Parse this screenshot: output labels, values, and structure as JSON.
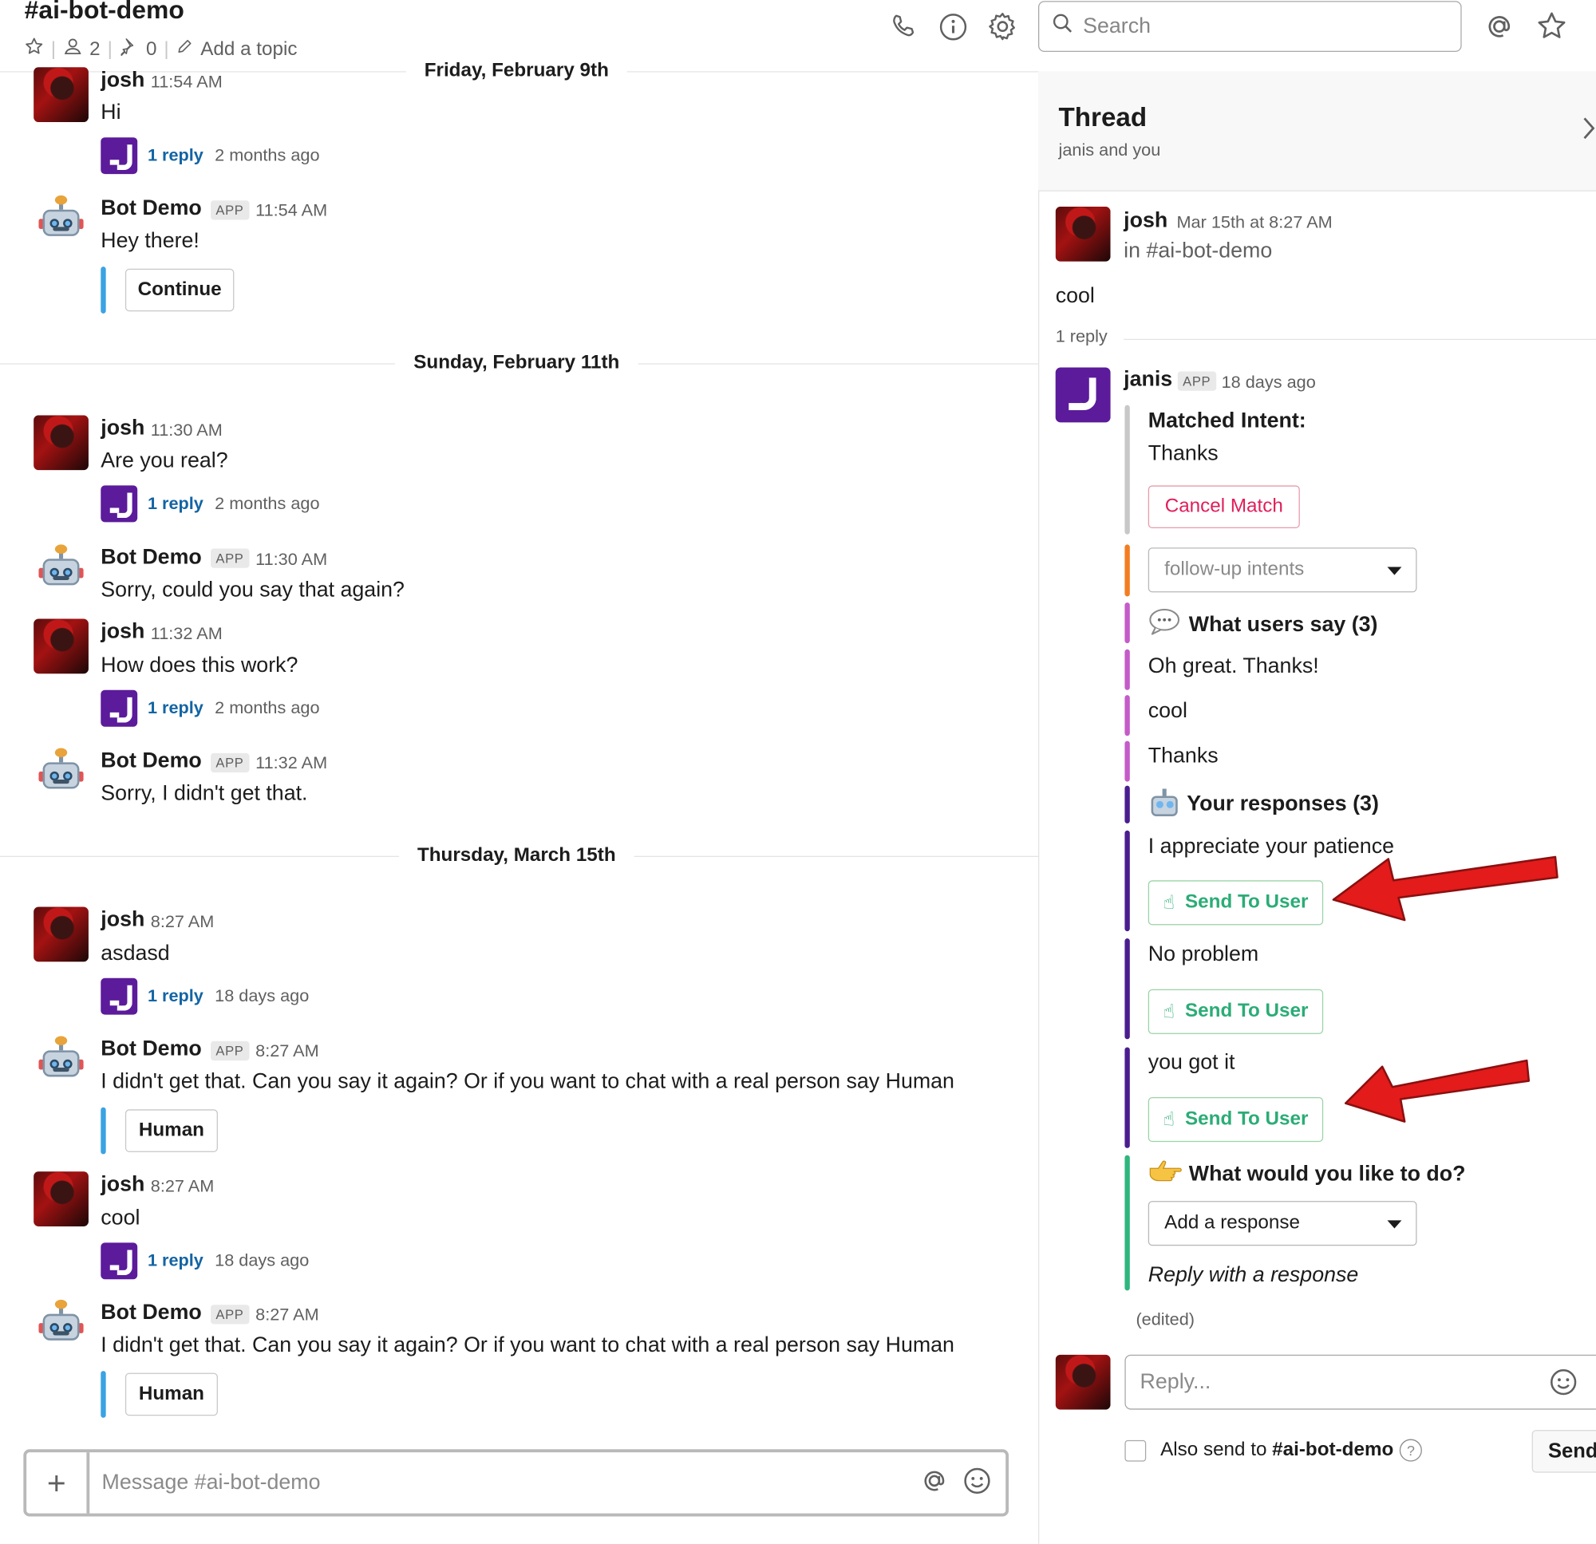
{
  "channel": {
    "name": "#ai-bot-demo",
    "members": "2",
    "pins": "0",
    "topic_placeholder": "Add a topic"
  },
  "header": {
    "search_placeholder": "Search",
    "icons": [
      "phone-icon",
      "info-icon",
      "gear-icon",
      "search-icon",
      "at-icon",
      "star-icon"
    ]
  },
  "day_dividers": [
    "Friday, February 9th",
    "Sunday, February 11th",
    "Thursday, March 15th"
  ],
  "messages": [
    {
      "author": "josh",
      "time": "11:54 AM",
      "text": "Hi",
      "reply": "1 reply",
      "reply_ago": "2 months ago"
    },
    {
      "author": "Bot Demo",
      "tag": "APP",
      "time": "11:54 AM",
      "text": "Hey there!",
      "button": "Continue"
    },
    {
      "author": "josh",
      "time": "11:30 AM",
      "text": "Are you real?",
      "reply": "1 reply",
      "reply_ago": "2 months ago"
    },
    {
      "author": "Bot Demo",
      "tag": "APP",
      "time": "11:30 AM",
      "text": "Sorry, could you say that again?"
    },
    {
      "author": "josh",
      "time": "11:32 AM",
      "text": "How does this work?",
      "reply": "1 reply",
      "reply_ago": "2 months ago"
    },
    {
      "author": "Bot Demo",
      "tag": "APP",
      "time": "11:32 AM",
      "text": "Sorry, I didn't get that."
    },
    {
      "author": "josh",
      "time": "8:27 AM",
      "text": "asdasd",
      "reply": "1 reply",
      "reply_ago": "18 days ago"
    },
    {
      "author": "Bot Demo",
      "tag": "APP",
      "time": "8:27 AM",
      "text": "I didn't get that. Can you say it again? Or if you want to chat with a real person say Human",
      "button": "Human"
    },
    {
      "author": "josh",
      "time": "8:27 AM",
      "text": "cool",
      "reply": "1 reply",
      "reply_ago": "18 days ago"
    },
    {
      "author": "Bot Demo",
      "tag": "APP",
      "time": "8:27 AM",
      "text": "I didn't get that. Can you say it again? Or if you want to chat with a real person say Human",
      "button": "Human"
    }
  ],
  "composer": {
    "placeholder": "Message #ai-bot-demo"
  },
  "thread": {
    "title": "Thread",
    "subtitle": "janis and you",
    "parent": {
      "author": "josh",
      "time": "Mar 15th at 8:27 AM",
      "channel": "in #ai-bot-demo",
      "text": "cool"
    },
    "reply_count": "1 reply",
    "reply": {
      "author": "janis",
      "tag": "APP",
      "ago": "18 days ago",
      "matched_label": "Matched Intent:",
      "matched_value": "Thanks",
      "cancel_button": "Cancel Match",
      "followup_select": "follow-up intents",
      "users_say_header": "What users say (3)",
      "users_say": [
        "Oh great.  Thanks!",
        "cool",
        "Thanks"
      ],
      "responses_header": "Your responses (3)",
      "responses": [
        "I appreciate your patience",
        "No problem",
        "you got it"
      ],
      "send_button": "Send To User",
      "action_header": "What would you like to do?",
      "action_select": "Add a response",
      "reply_hint": "Reply with a response",
      "edited": "(edited)"
    },
    "reply_box_placeholder": "Reply...",
    "also_send_prefix": "Also send to ",
    "also_send_channel": "#ai-bot-demo",
    "send_label": "Send"
  },
  "colors": {
    "link": "#1264a3",
    "janis": "#5b1b9b",
    "attachment_blue": "#3aa3e3",
    "cancel_red": "#e01e5a",
    "send_green": "#2bac76",
    "bar_orange": "#f47c20",
    "bar_pink": "#c55bc9",
    "bar_purple": "#4a1d8f",
    "bar_green": "#2eb67d",
    "arrow_red": "#e31b1b"
  }
}
